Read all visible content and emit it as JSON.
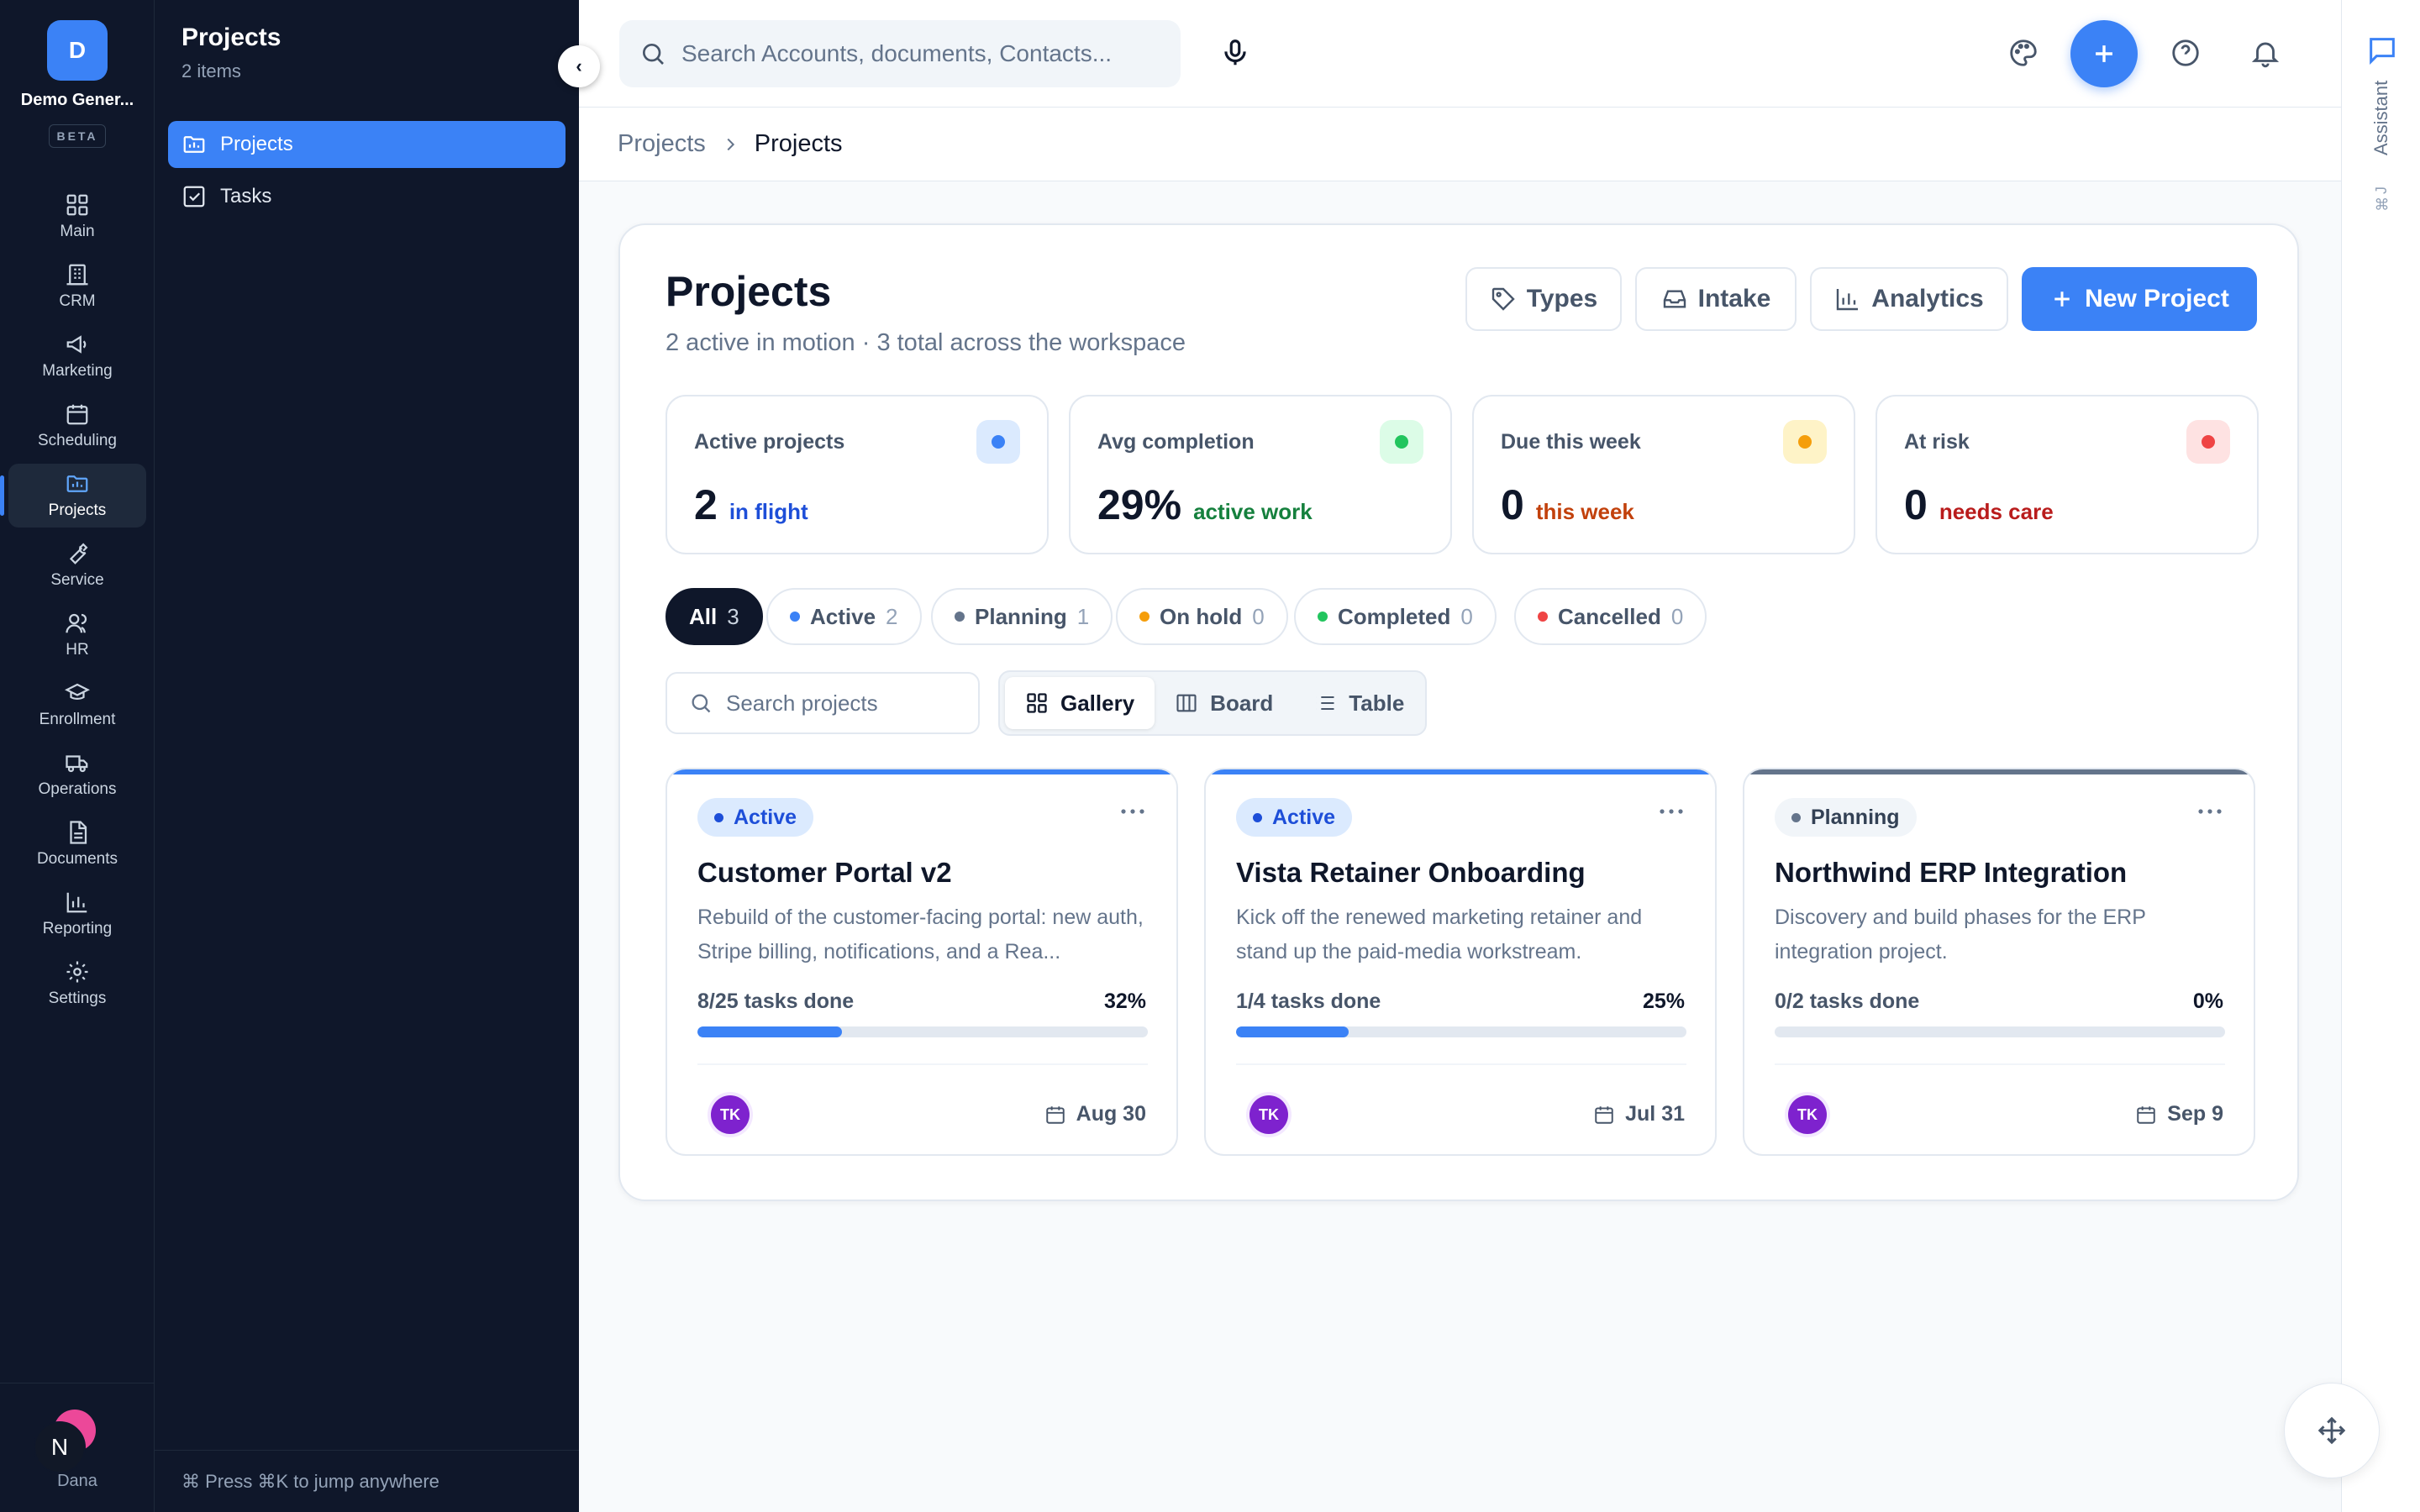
{
  "rail": {
    "logo_letter": "D",
    "org_name": "Demo Gener...",
    "beta": "BETA",
    "items": [
      {
        "label": "Main",
        "icon": "grid-icon"
      },
      {
        "label": "CRM",
        "icon": "building-icon"
      },
      {
        "label": "Marketing",
        "icon": "megaphone-icon"
      },
      {
        "label": "Scheduling",
        "icon": "calendar-icon"
      },
      {
        "label": "Projects",
        "icon": "folder-chart-icon",
        "active": true
      },
      {
        "label": "Service",
        "icon": "wrench-icon"
      },
      {
        "label": "HR",
        "icon": "users-icon"
      },
      {
        "label": "Enrollment",
        "icon": "graduation-cap-icon"
      },
      {
        "label": "Operations",
        "icon": "truck-icon"
      },
      {
        "label": "Documents",
        "icon": "document-icon"
      },
      {
        "label": "Reporting",
        "icon": "bar-chart-icon"
      },
      {
        "label": "Settings",
        "icon": "gear-icon"
      }
    ],
    "user_initial": "N",
    "user_name": "Dana"
  },
  "subnav": {
    "title": "Projects",
    "count": "2 items",
    "collapse_glyph": "‹",
    "items": [
      {
        "label": "Projects",
        "active": true
      },
      {
        "label": "Tasks"
      }
    ],
    "footer": "⌘ Press ⌘K to jump anywhere"
  },
  "topbar": {
    "search_placeholder": "Search Accounts, documents, Contacts..."
  },
  "assistant": {
    "label": "Assistant",
    "shortcut": "⌘J"
  },
  "breadcrumb": {
    "parent": "Projects",
    "separator": ">",
    "current": "Projects"
  },
  "header": {
    "title": "Projects",
    "subtitle": "2 active in motion · 3 total across the workspace",
    "buttons": {
      "types": "Types",
      "intake": "Intake",
      "analytics": "Analytics",
      "new_project": "New Project"
    }
  },
  "stats": [
    {
      "label": "Active projects",
      "value": "2",
      "note": "in flight",
      "color": "#3b82f6",
      "bg": "#dbeafe",
      "note_color": "#1d4ed8"
    },
    {
      "label": "Avg completion",
      "value": "29%",
      "note": "active work",
      "color": "#22c55e",
      "bg": "#dcfce7",
      "note_color": "#15803d"
    },
    {
      "label": "Due this week",
      "value": "0",
      "note": "this week",
      "color": "#f59e0b",
      "bg": "#fef3c7",
      "note_color": "#c2410c"
    },
    {
      "label": "At risk",
      "value": "0",
      "note": "needs care",
      "color": "#ef4444",
      "bg": "#fee2e2",
      "note_color": "#b91c1c"
    }
  ],
  "filters": [
    {
      "label": "All",
      "count": "3",
      "active": true
    },
    {
      "label": "Active",
      "count": "2",
      "color": "#3b82f6"
    },
    {
      "label": "Planning",
      "count": "1",
      "color": "#64748b"
    },
    {
      "label": "On hold",
      "count": "0",
      "color": "#f59e0b"
    },
    {
      "label": "Completed",
      "count": "0",
      "color": "#22c55e"
    },
    {
      "label": "Cancelled",
      "count": "0",
      "color": "#ef4444"
    }
  ],
  "toolbar": {
    "search_placeholder": "Search projects",
    "views": [
      {
        "label": "Gallery",
        "active": true
      },
      {
        "label": "Board"
      },
      {
        "label": "Table"
      }
    ]
  },
  "projects": [
    {
      "status": "Active",
      "title": "Customer Portal v2",
      "description": "Rebuild of the customer-facing portal: new auth, Stripe billing, notifications, and a Rea...",
      "tasks_done": "8/25 tasks done",
      "percent_label": "32%",
      "progress": 0.32,
      "owner": "TK",
      "due": "Aug 30",
      "accent": "#3b82f6",
      "badge_bg": "#dbeafe",
      "badge_color": "#1d4ed8"
    },
    {
      "status": "Active",
      "title": "Vista Retainer Onboarding",
      "description": "Kick off the renewed marketing retainer and stand up the paid-media workstream.",
      "tasks_done": "1/4 tasks done",
      "percent_label": "25%",
      "progress": 0.25,
      "owner": "TK",
      "due": "Jul 31",
      "accent": "#3b82f6",
      "badge_bg": "#dbeafe",
      "badge_color": "#1d4ed8"
    },
    {
      "status": "Planning",
      "title": "Northwind ERP Integration",
      "description": "Discovery and build phases for the ERP integration project.",
      "tasks_done": "0/2 tasks done",
      "percent_label": "0%",
      "progress": 0,
      "owner": "TK",
      "due": "Sep 9",
      "accent": "#64748b",
      "badge_bg": "#f1f5f9",
      "badge_color": "#334155"
    }
  ]
}
